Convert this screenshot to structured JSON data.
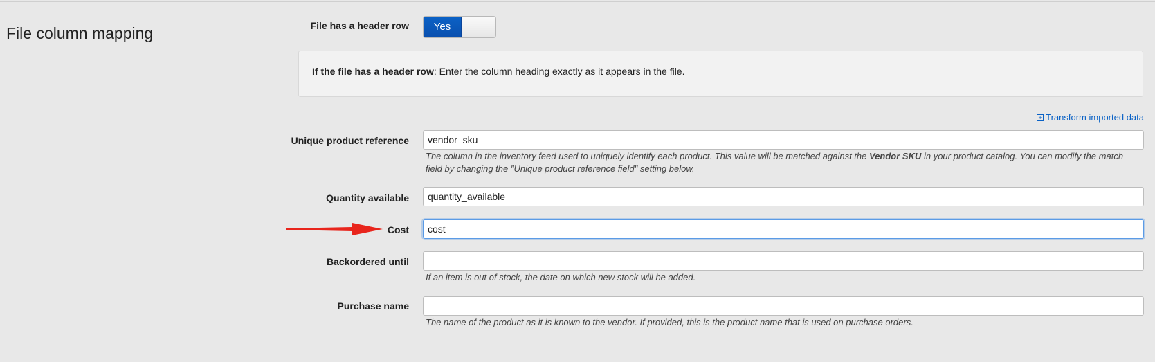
{
  "section": {
    "title": "File column mapping"
  },
  "header_row": {
    "label": "File has a header row",
    "toggle_on_label": "Yes"
  },
  "info": {
    "bold_prefix": "If the file has a header row",
    "rest": ": Enter the column heading exactly as it appears in the file."
  },
  "transform_link": {
    "label": "Transform imported data"
  },
  "fields": {
    "unique_ref": {
      "label": "Unique product reference",
      "value": "vendor_sku",
      "help_part1": "The column in the inventory feed used to uniquely identify each product. This value will be matched against the ",
      "help_bold": "Vendor SKU",
      "help_part2": " in your product catalog. You can modify the match field by changing the \"Unique product reference field\" setting below."
    },
    "quantity": {
      "label": "Quantity available",
      "value": "quantity_available"
    },
    "cost": {
      "label": "Cost",
      "value": "cost"
    },
    "backordered": {
      "label": "Backordered until",
      "value": "",
      "help": "If an item is out of stock, the date on which new stock will be added."
    },
    "purchase_name": {
      "label": "Purchase name",
      "value": "",
      "help": "The name of the product as it is known to the vendor. If provided, this is the product name that is used on purchase orders."
    }
  },
  "colors": {
    "background": "#e8e8e8",
    "toggle_on": "#0a4fae",
    "link": "#0a62c6",
    "arrow": "#e8251c",
    "focus_border": "#5b9be6"
  },
  "icons": {
    "transform": "plus-square-icon",
    "pointer": "red-arrow-annotation"
  }
}
